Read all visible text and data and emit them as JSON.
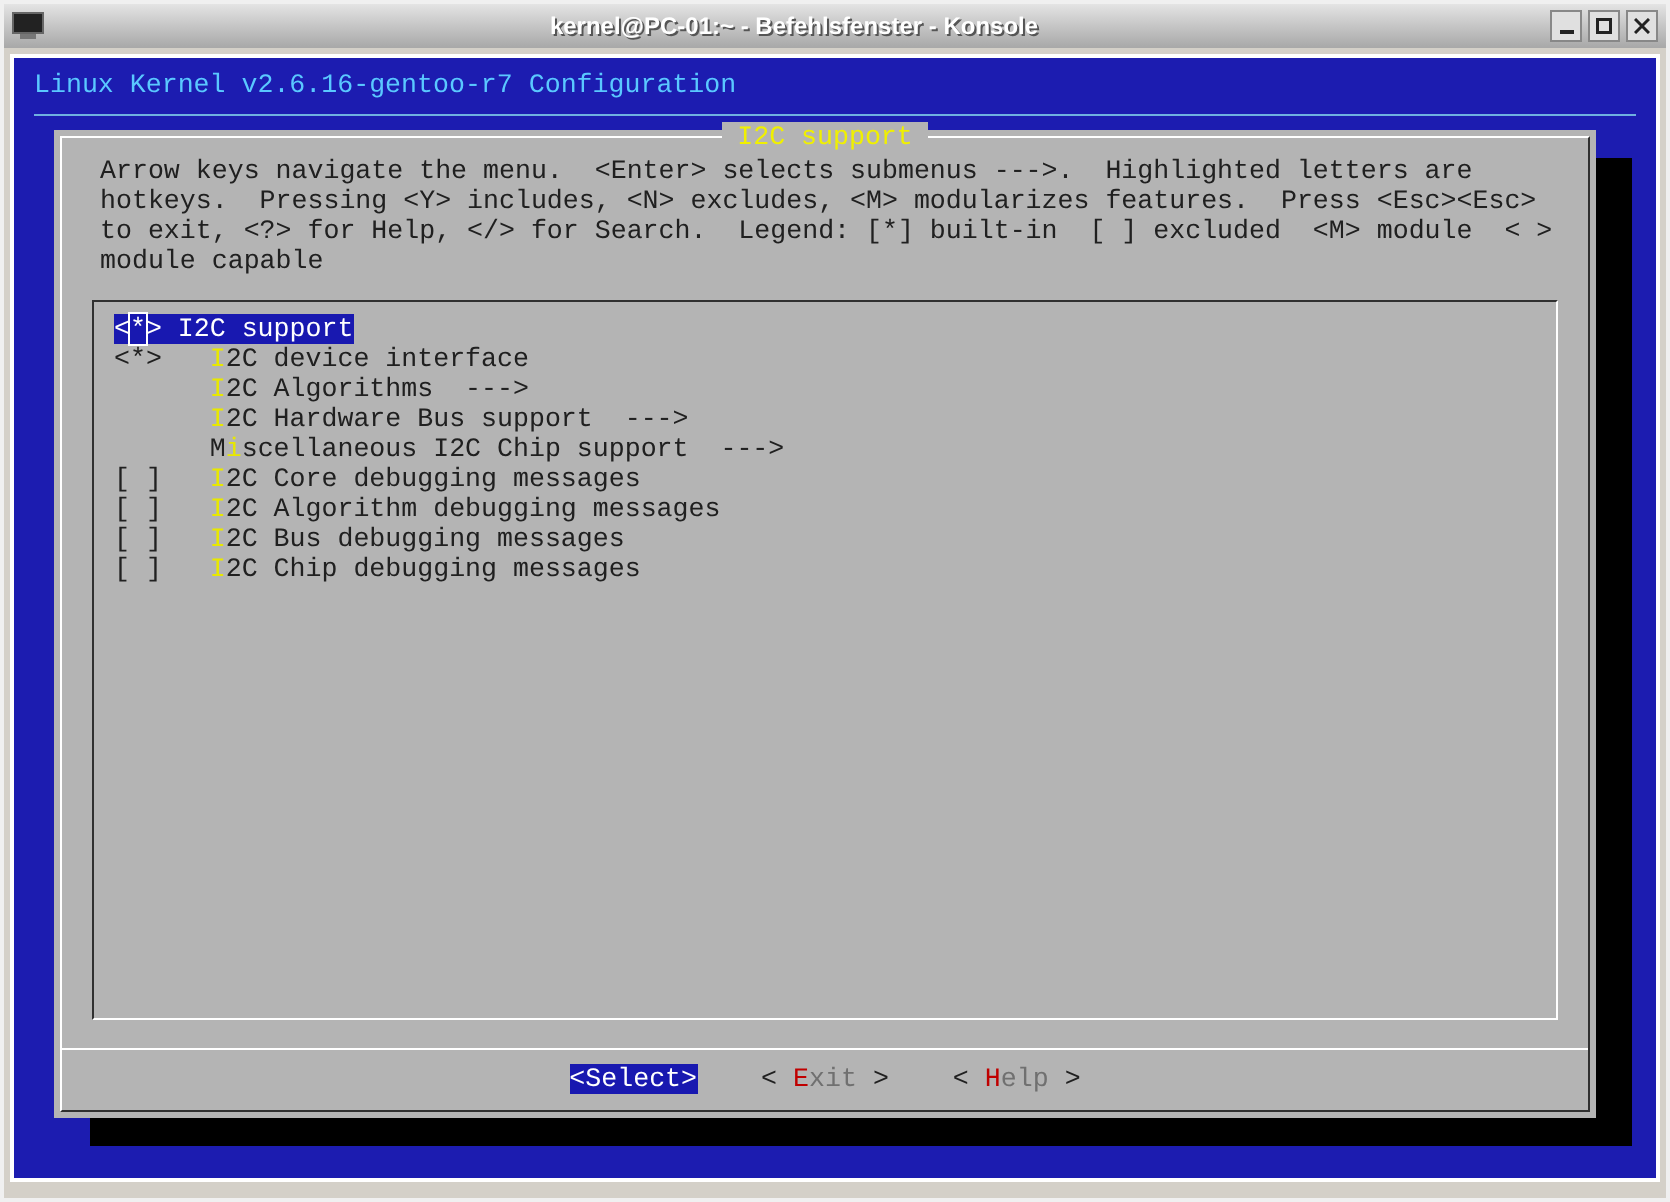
{
  "window": {
    "title": "kernel@PC-01:~ - Befehlsfenster - Konsole"
  },
  "header": "Linux Kernel v2.6.16-gentoo-r7 Configuration",
  "dialog": {
    "title": "I2C support",
    "help_lines": [
      "Arrow keys navigate the menu.  <Enter> selects submenus --->.  Highlighted letters are",
      "hotkeys.  Pressing <Y> includes, <N> excludes, <M> modularizes features.  Press <Esc><Esc>",
      "to exit, <?> for Help, </> for Search.  Legend: [*] built-in  [ ] excluded  <M> module  < >",
      "module capable"
    ],
    "menu": [
      {
        "prefix_open": "<",
        "prefix_mark": "*",
        "prefix_close": ">",
        "hotkey": "I",
        "label_rest": "2C support",
        "selected": true,
        "children": [
          {
            "prefix_open": "<",
            "prefix_mark": "*",
            "prefix_close": ">",
            "hotkey": "I",
            "label_rest": "2C device interface",
            "selected": false
          },
          {
            "hotkey": "I",
            "label_rest": "2C Algorithms  --->",
            "selected": false
          },
          {
            "hotkey": "I",
            "label_rest": "2C Hardware Bus support  --->",
            "selected": false
          },
          {
            "label_start": "M",
            "hotkey": "i",
            "label_rest": "scellaneous I2C Chip support  --->",
            "selected": false
          },
          {
            "prefix_open": "[",
            "prefix_close": "]",
            "hotkey": "I",
            "label_rest": "2C Core debugging messages",
            "selected": false
          },
          {
            "prefix_open": "[",
            "prefix_close": "]",
            "hotkey": "I",
            "label_rest": "2C Algorithm debugging messages",
            "selected": false
          },
          {
            "prefix_open": "[",
            "prefix_close": "]",
            "hotkey": "I",
            "label_rest": "2C Bus debugging messages",
            "selected": false
          },
          {
            "prefix_open": "[",
            "prefix_close": "]",
            "hotkey": "I",
            "label_rest": "2C Chip debugging messages",
            "selected": false
          }
        ]
      }
    ],
    "buttons": [
      {
        "left": "<",
        "hotkey": "S",
        "rest": "elect",
        "right": ">",
        "selected": true
      },
      {
        "left": "<",
        "hotkey": "E",
        "rest": "xit",
        "right": ">",
        "selected": false
      },
      {
        "left": "<",
        "hotkey": "H",
        "rest": "elp",
        "right": ">",
        "selected": false
      }
    ]
  }
}
